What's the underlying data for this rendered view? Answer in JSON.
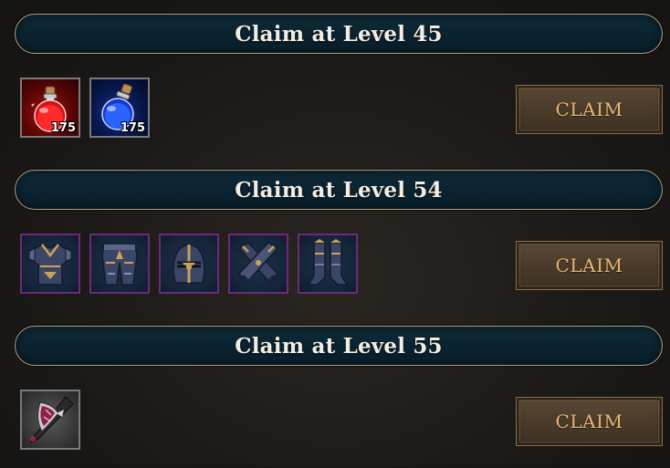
{
  "tiers": [
    {
      "title": "Claim at Level 45",
      "button_label": "CLAIM",
      "rewards": [
        {
          "icon": "red-health-potion-icon",
          "quantity": "175"
        },
        {
          "icon": "blue-mana-potion-icon",
          "quantity": "175"
        }
      ]
    },
    {
      "title": "Claim at Level 54",
      "button_label": "CLAIM",
      "rewards": [
        {
          "icon": "chest-armor-icon"
        },
        {
          "icon": "leg-armor-icon"
        },
        {
          "icon": "helmet-icon"
        },
        {
          "icon": "gauntlets-icon"
        },
        {
          "icon": "boots-icon"
        }
      ]
    },
    {
      "title": "Claim at Level 55",
      "button_label": "CLAIM",
      "rewards": [
        {
          "icon": "battle-axe-icon"
        }
      ]
    }
  ],
  "colors": {
    "header_bg": "#0b2330",
    "header_border": "#b9a27a",
    "button_bg": "#4a3b2a",
    "button_text": "#e9b776",
    "epic_border": "#6e2a79"
  }
}
